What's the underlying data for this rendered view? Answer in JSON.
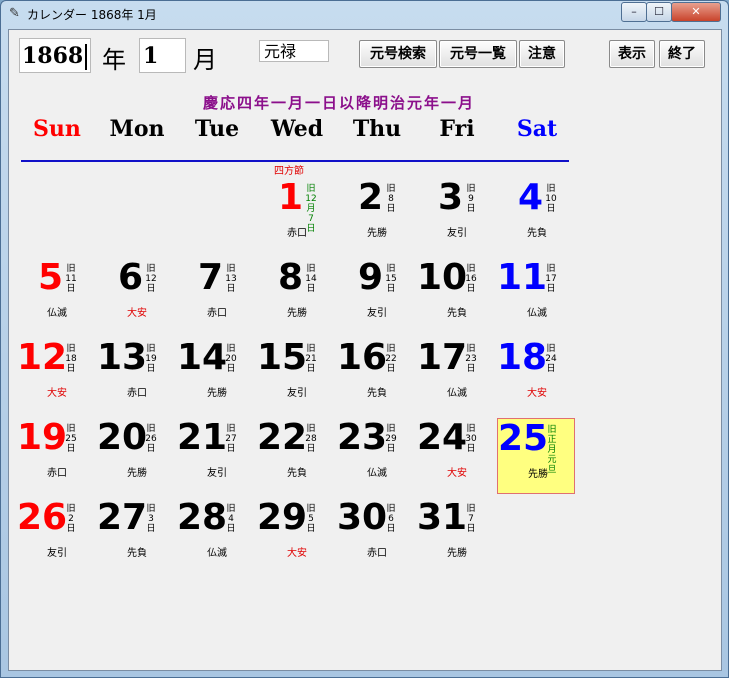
{
  "window": {
    "title": "カレンダー 1868年  1月",
    "min_label": "–",
    "max_label": "☐",
    "close_label": "✕"
  },
  "controls": {
    "year_value": "1868",
    "year_unit": "年",
    "month_value": "1",
    "month_unit": "月",
    "era_value": "元禄",
    "buttons": {
      "era_search": "元号検索",
      "era_list": "元号一覧",
      "notes": "注意",
      "show": "表示",
      "quit": "終了"
    }
  },
  "caption": "慶応四年一月一日以降明治元年一月",
  "weekdays": [
    "Sun",
    "Mon",
    "Tue",
    "Wed",
    "Thu",
    "Fri",
    "Sat"
  ],
  "colors": {
    "sunday": "#ff0000",
    "saturday": "#0000ff",
    "weekday": "#000000",
    "today_bg": "#ffff80",
    "caption": "#8b0f8b",
    "divider": "#1010c8"
  },
  "days": [
    {
      "day": "1",
      "old": "旧12月7日",
      "rokuyo": "赤口",
      "col": 3,
      "row": 0,
      "color": "red",
      "old_green": true,
      "note": "四方節"
    },
    {
      "day": "2",
      "old": "旧8日",
      "rokuyo": "先勝",
      "col": 4,
      "row": 0,
      "color": "black"
    },
    {
      "day": "3",
      "old": "旧9日",
      "rokuyo": "友引",
      "col": 5,
      "row": 0,
      "color": "black"
    },
    {
      "day": "4",
      "old": "旧10日",
      "rokuyo": "先負",
      "col": 6,
      "row": 0,
      "color": "blue"
    },
    {
      "day": "5",
      "old": "旧11日",
      "rokuyo": "仏滅",
      "col": 0,
      "row": 1,
      "color": "red"
    },
    {
      "day": "6",
      "old": "旧12日",
      "rokuyo": "大安",
      "col": 1,
      "row": 1,
      "color": "black",
      "rokuyo_red": true
    },
    {
      "day": "7",
      "old": "旧13日",
      "rokuyo": "赤口",
      "col": 2,
      "row": 1,
      "color": "black"
    },
    {
      "day": "8",
      "old": "旧14日",
      "rokuyo": "先勝",
      "col": 3,
      "row": 1,
      "color": "black"
    },
    {
      "day": "9",
      "old": "旧15日",
      "rokuyo": "友引",
      "col": 4,
      "row": 1,
      "color": "black"
    },
    {
      "day": "10",
      "old": "旧16日",
      "rokuyo": "先負",
      "col": 5,
      "row": 1,
      "color": "black"
    },
    {
      "day": "11",
      "old": "旧17日",
      "rokuyo": "仏滅",
      "col": 6,
      "row": 1,
      "color": "blue"
    },
    {
      "day": "12",
      "old": "旧18日",
      "rokuyo": "大安",
      "col": 0,
      "row": 2,
      "color": "red",
      "rokuyo_red": true
    },
    {
      "day": "13",
      "old": "旧19日",
      "rokuyo": "赤口",
      "col": 1,
      "row": 2,
      "color": "black"
    },
    {
      "day": "14",
      "old": "旧20日",
      "rokuyo": "先勝",
      "col": 2,
      "row": 2,
      "color": "black"
    },
    {
      "day": "15",
      "old": "旧21日",
      "rokuyo": "友引",
      "col": 3,
      "row": 2,
      "color": "black"
    },
    {
      "day": "16",
      "old": "旧22日",
      "rokuyo": "先負",
      "col": 4,
      "row": 2,
      "color": "black"
    },
    {
      "day": "17",
      "old": "旧23日",
      "rokuyo": "仏滅",
      "col": 5,
      "row": 2,
      "color": "black"
    },
    {
      "day": "18",
      "old": "旧24日",
      "rokuyo": "大安",
      "col": 6,
      "row": 2,
      "color": "blue",
      "rokuyo_red": true
    },
    {
      "day": "19",
      "old": "旧25日",
      "rokuyo": "赤口",
      "col": 0,
      "row": 3,
      "color": "red"
    },
    {
      "day": "20",
      "old": "旧26日",
      "rokuyo": "先勝",
      "col": 1,
      "row": 3,
      "color": "black"
    },
    {
      "day": "21",
      "old": "旧27日",
      "rokuyo": "友引",
      "col": 2,
      "row": 3,
      "color": "black"
    },
    {
      "day": "22",
      "old": "旧28日",
      "rokuyo": "先負",
      "col": 3,
      "row": 3,
      "color": "black"
    },
    {
      "day": "23",
      "old": "旧29日",
      "rokuyo": "仏滅",
      "col": 4,
      "row": 3,
      "color": "black"
    },
    {
      "day": "24",
      "old": "旧30日",
      "rokuyo": "大安",
      "col": 5,
      "row": 3,
      "color": "black",
      "rokuyo_red": true
    },
    {
      "day": "25",
      "old": "旧正月元旦",
      "rokuyo": "先勝",
      "col": 6,
      "row": 3,
      "color": "blue",
      "old_green": true,
      "today": true
    },
    {
      "day": "26",
      "old": "旧2日",
      "rokuyo": "友引",
      "col": 0,
      "row": 4,
      "color": "red"
    },
    {
      "day": "27",
      "old": "旧3日",
      "rokuyo": "先負",
      "col": 1,
      "row": 4,
      "color": "black"
    },
    {
      "day": "28",
      "old": "旧4日",
      "rokuyo": "仏滅",
      "col": 2,
      "row": 4,
      "color": "black"
    },
    {
      "day": "29",
      "old": "旧5日",
      "rokuyo": "大安",
      "col": 3,
      "row": 4,
      "color": "black",
      "rokuyo_red": true
    },
    {
      "day": "30",
      "old": "旧6日",
      "rokuyo": "赤口",
      "col": 4,
      "row": 4,
      "color": "black"
    },
    {
      "day": "31",
      "old": "旧7日",
      "rokuyo": "先勝",
      "col": 5,
      "row": 4,
      "color": "black"
    }
  ]
}
